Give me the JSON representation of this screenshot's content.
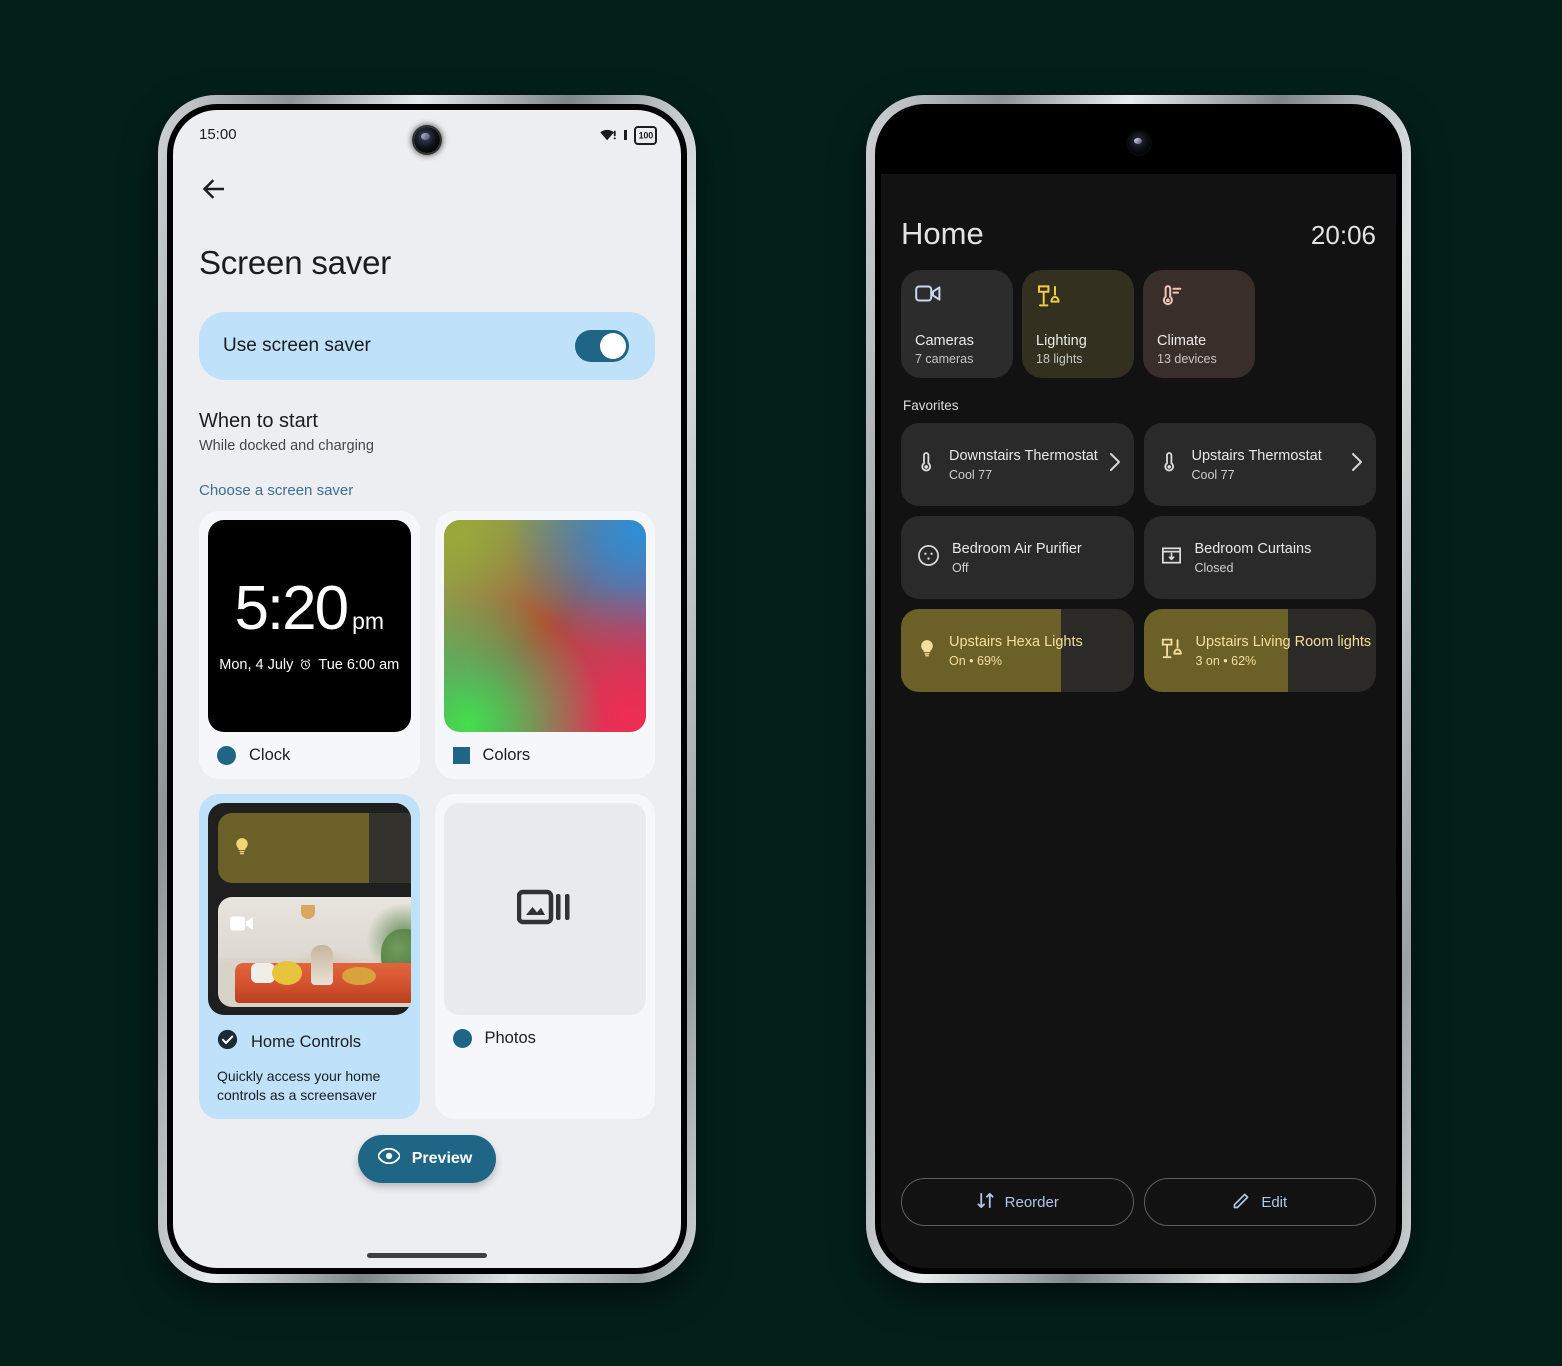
{
  "background_color": "#032018",
  "left_phone": {
    "status_bar": {
      "time": "15:00",
      "battery": "100",
      "wifi_icon": "wifi-alert-icon"
    },
    "back_icon": "back-arrow-icon",
    "page_title": "Screen saver",
    "use_screen_saver": {
      "label": "Use screen saver",
      "enabled": true,
      "accent": "#1f6585",
      "card_bg": "#bfe1fa"
    },
    "when_to_start": {
      "title": "When to start",
      "subtitle": "While docked and charging"
    },
    "choose_label": "Choose a screen saver",
    "screensavers": [
      {
        "name": "Clock",
        "marker": "dot",
        "selected": false,
        "preview": {
          "type": "clock",
          "time": "5:20",
          "meridiem": "pm",
          "date": "Mon, 4 July",
          "alarm_icon": "alarm-icon",
          "alarm": "Tue 6:00 am"
        }
      },
      {
        "name": "Colors",
        "marker": "square",
        "selected": false,
        "preview": {
          "type": "gradient"
        }
      },
      {
        "name": "Home Controls",
        "marker": "check",
        "selected": true,
        "description": "Quickly access your home controls as a screensaver",
        "preview": {
          "type": "home-controls",
          "light_icon": "lightbulb-icon",
          "camera_icon": "video-camera-icon"
        }
      },
      {
        "name": "Photos",
        "marker": "dot",
        "selected": false,
        "preview": {
          "type": "photos",
          "icon": "photo-slideshow-icon"
        }
      }
    ],
    "preview_button": {
      "label": "Preview",
      "icon": "eye-icon",
      "color": "#1f6585"
    }
  },
  "right_phone": {
    "header": {
      "title": "Home",
      "time": "20:06"
    },
    "categories": [
      {
        "name": "Cameras",
        "sub": "7 cameras",
        "icon": "video-camera-icon",
        "bg": "#2c2c2c",
        "icon_color": "#c9d7f0"
      },
      {
        "name": "Lighting",
        "sub": "18 lights",
        "icon": "lamp-icon",
        "bg": "#33301f",
        "icon_color": "#f2cb45"
      },
      {
        "name": "Climate",
        "sub": "13 devices",
        "icon": "thermostat-icon",
        "bg": "#3a2e2a",
        "icon_color": "#f0c4b4"
      }
    ],
    "favorites_label": "Favorites",
    "favorites": [
      {
        "name": "Downstairs Thermostat",
        "state": "Cool 77",
        "icon": "thermostat-icon",
        "chevron": true,
        "type": "plain"
      },
      {
        "name": "Upstairs Thermostat",
        "state": "Cool 77",
        "icon": "thermostat-icon",
        "chevron": true,
        "type": "plain"
      },
      {
        "name": "Bedroom Air Purifier",
        "state": "Off",
        "icon": "air-purifier-icon",
        "chevron": false,
        "type": "plain"
      },
      {
        "name": "Bedroom Curtains",
        "state": "Closed",
        "icon": "curtains-icon",
        "chevron": false,
        "type": "plain"
      },
      {
        "name": "Upstairs Hexa Lights",
        "state": "On • 69%",
        "icon": "lightbulb-icon",
        "chevron": false,
        "type": "light",
        "fill_percent": 69
      },
      {
        "name": "Upstairs Living Room lights",
        "state": "3 on • 62%",
        "icon": "lamp-icon",
        "chevron": false,
        "type": "light",
        "fill_percent": 62
      }
    ],
    "camera_feed": {
      "label": "blurred-camera-feed"
    },
    "buttons": [
      {
        "label": "Reorder",
        "icon": "reorder-icon"
      },
      {
        "label": "Edit",
        "icon": "pencil-icon"
      }
    ]
  }
}
